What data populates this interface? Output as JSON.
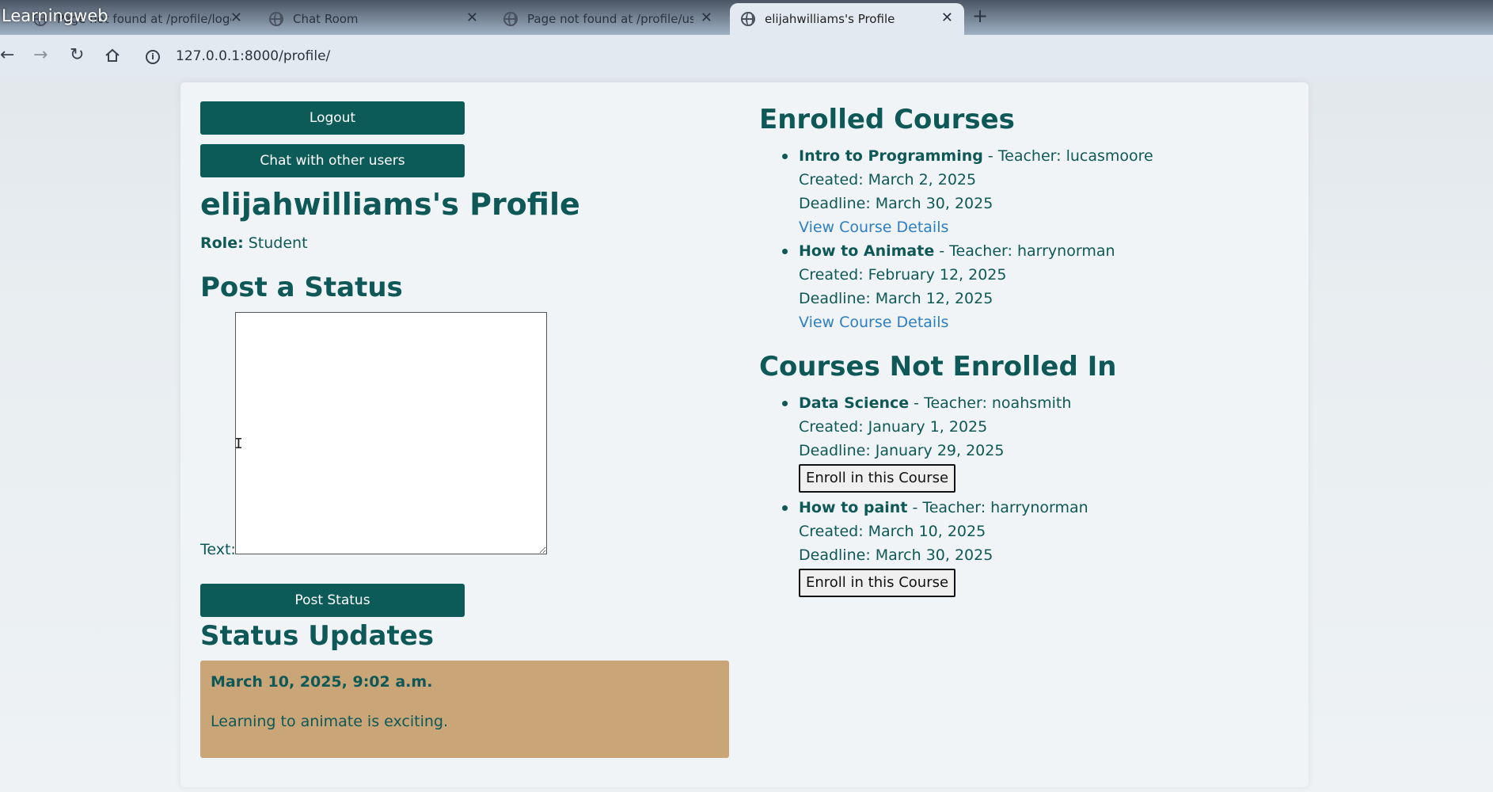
{
  "overlay": {
    "title": "Learningweb"
  },
  "browser": {
    "tabs": [
      {
        "title": "Page not found at /profile/logo"
      },
      {
        "title": "Chat Room"
      },
      {
        "title": "Page not found at /profile/user"
      },
      {
        "title": "elijahwilliams's Profile"
      }
    ],
    "url": "127.0.0.1:8000/profile/"
  },
  "sidebar_actions": {
    "logout_label": "Logout",
    "chat_label": "Chat with other users"
  },
  "profile": {
    "title": "elijahwilliams's Profile",
    "role_label": "Role:",
    "role_value": "Student"
  },
  "post_status": {
    "heading": "Post a Status",
    "text_label": "Text:",
    "text_value": "",
    "submit_label": "Post Status"
  },
  "status_updates": {
    "heading": "Status Updates",
    "items": [
      {
        "date": "March 10, 2025, 9:02 a.m.",
        "text": "Learning to animate is exciting."
      }
    ]
  },
  "enrolled": {
    "heading": "Enrolled Courses",
    "courses": [
      {
        "name": "Intro to Programming",
        "teacher": " - Teacher: lucasmoore",
        "created": "Created: March 2, 2025",
        "deadline": "Deadline: March 30, 2025",
        "link": "View Course Details"
      },
      {
        "name": "How to Animate",
        "teacher": " - Teacher: harrynorman",
        "created": "Created: February 12, 2025",
        "deadline": "Deadline: March 12, 2025",
        "link": "View Course Details"
      }
    ]
  },
  "not_enrolled": {
    "heading": "Courses Not Enrolled In",
    "courses": [
      {
        "name": "Data Science",
        "teacher": " - Teacher: noahsmith",
        "created": "Created: January 1, 2025",
        "deadline": "Deadline: January 29, 2025",
        "button": "Enroll in this Course"
      },
      {
        "name": "How to paint",
        "teacher": " - Teacher: harrynorman",
        "created": "Created: March 10, 2025",
        "deadline": "Deadline: March 30, 2025",
        "button": "Enroll in this Course"
      }
    ]
  }
}
